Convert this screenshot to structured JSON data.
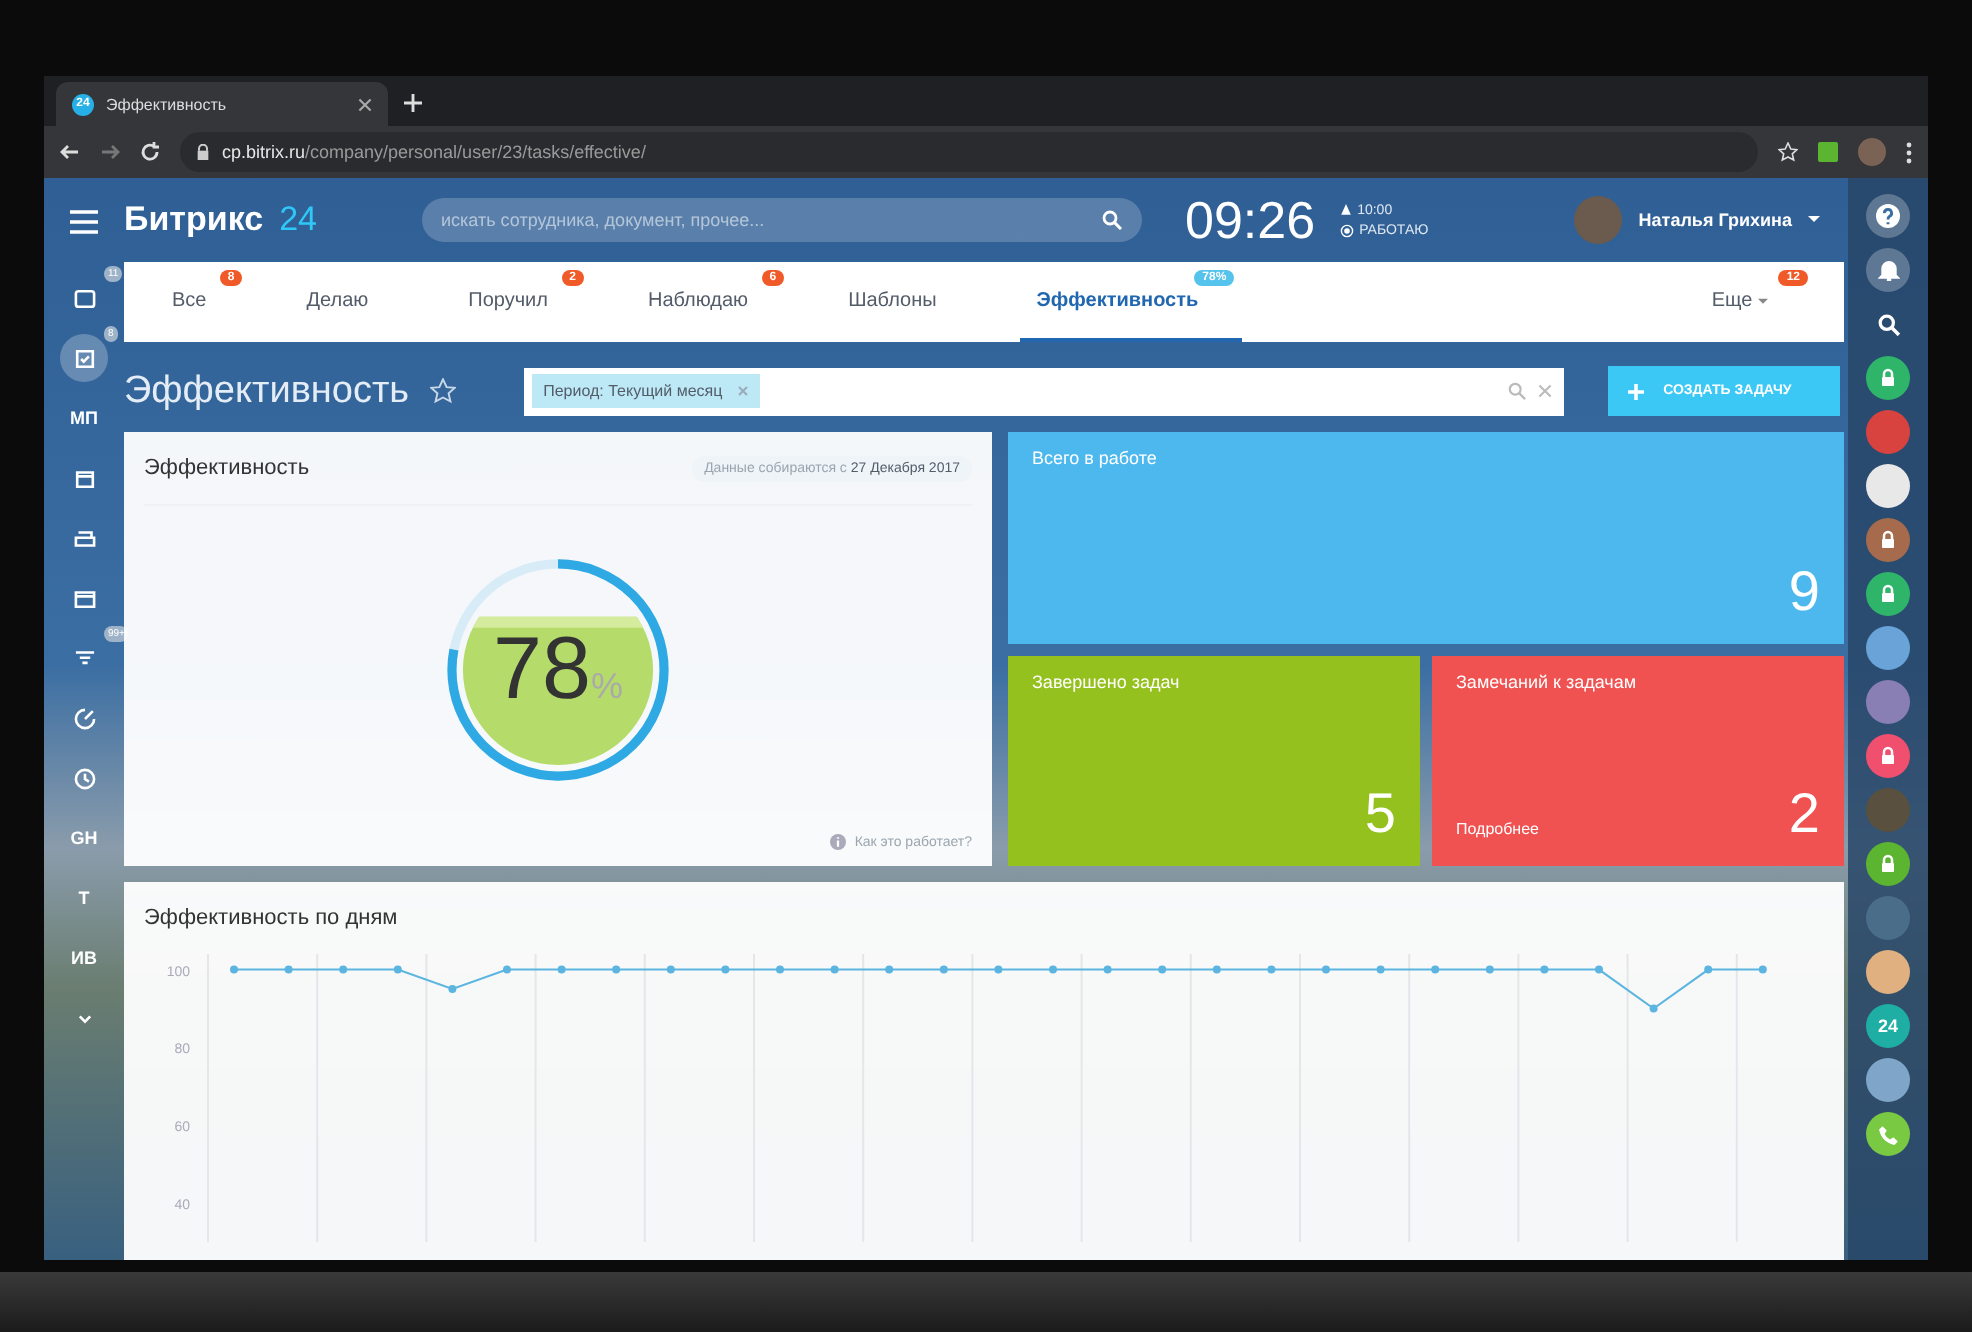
{
  "browser": {
    "tab": {
      "favicon": "24",
      "title": "Эффективность"
    },
    "url": "**cp.bitrix.ru**/company/personal/user/23/tasks/effective/"
  },
  "header": {
    "logo": "Битрикс",
    "logo_number": "24",
    "search": {
      "placeholder": "искать сотрудника, документ, прочее..."
    },
    "time": "09:26",
    "alarm": "10:00",
    "status": "РАБОТАЮ",
    "user": "Наталья Грихина"
  },
  "left_sidebar": [
    {
      "kind": "icon",
      "badge": "11",
      "selected": false
    },
    {
      "kind": "icon",
      "badge": "8",
      "selected": true
    },
    {
      "kind": "text",
      "label": "МП",
      "selected": false
    },
    {
      "kind": "icon",
      "selected": false
    },
    {
      "kind": "icon",
      "selected": false
    },
    {
      "kind": "icon",
      "selected": false
    },
    {
      "kind": "icon",
      "badge": "99+",
      "selected": false
    },
    {
      "kind": "icon",
      "selected": false
    },
    {
      "kind": "icon",
      "selected": false
    },
    {
      "kind": "text",
      "label": "GH",
      "selected": false
    },
    {
      "kind": "text",
      "label": "Т",
      "selected": false
    },
    {
      "kind": "text",
      "label": "ИВ",
      "selected": false
    },
    {
      "kind": "icon",
      "selected": false
    }
  ],
  "tabs": [
    {
      "label": "Все",
      "badge": "8",
      "selected": false
    },
    {
      "label": "Делаю",
      "selected": false
    },
    {
      "label": "Поручил",
      "badge": "2",
      "selected": false
    },
    {
      "label": "Наблюдаю",
      "badge": "6",
      "selected": false
    },
    {
      "label": "Шаблоны",
      "selected": false
    },
    {
      "label": "Эффективность",
      "badge": "78%",
      "selected": true
    }
  ],
  "more_tab": {
    "label": "Еще",
    "badge": "12"
  },
  "page_title": "Эффективность",
  "filter": {
    "chip": "Период: Текущий месяц"
  },
  "create_button": "СОЗДАТЬ ЗАДАЧУ",
  "efficiency": {
    "title": "Эффективность",
    "note": "Данные собираются с **27 Декабря 2017**",
    "value": "78",
    "unit": "%",
    "level": 0.78,
    "help": "Как это работает?"
  },
  "tiles": [
    {
      "label": "Всего в работе",
      "value": "9",
      "color": "#4db8ee"
    },
    {
      "label": "Завершено задач",
      "value": "5",
      "color": "#95c11f"
    },
    {
      "label": "Замечаний к задачам",
      "value": "2",
      "link": "Подробнее",
      "color": "#f05252"
    }
  ],
  "daily": {
    "title": "Эффективность по дням",
    "chart_data": {
      "type": "line",
      "ylim": [
        30,
        104
      ],
      "yticks": [
        40,
        60,
        80,
        100
      ],
      "series": [
        {
          "color": "#5bb5e0",
          "marker": "circle",
          "values": [
            100,
            100,
            100,
            100,
            95,
            100,
            100,
            100,
            100,
            100,
            100,
            100,
            100,
            100,
            100,
            100,
            100,
            100,
            100,
            100,
            100,
            100,
            100,
            100,
            100,
            100,
            90,
            100,
            100
          ]
        }
      ]
    }
  },
  "right_sidebar": {
    "contacts": [
      {
        "kind": "lock",
        "color": "#2fb56a"
      },
      {
        "kind": "avatar",
        "color": "#d9433f"
      },
      {
        "kind": "avatar",
        "color": "#e8e8e8"
      },
      {
        "kind": "lock",
        "color": "#a66a4c"
      },
      {
        "kind": "lock",
        "color": "#2fb56a"
      },
      {
        "kind": "avatar",
        "color": "#6aa3d8"
      },
      {
        "kind": "avatar",
        "color": "#8a7fb5"
      },
      {
        "kind": "lock",
        "color": "#f0506e"
      },
      {
        "kind": "avatar",
        "color": "#5a5040"
      },
      {
        "kind": "lock",
        "color": "#5cb531"
      },
      {
        "kind": "avatar",
        "color": "#4a6d8a"
      },
      {
        "kind": "avatar",
        "color": "#e0b080"
      },
      {
        "kind": "text",
        "label": "24",
        "color": "#1eaea3"
      },
      {
        "kind": "avatar",
        "color": "#7fa6c8"
      }
    ]
  }
}
